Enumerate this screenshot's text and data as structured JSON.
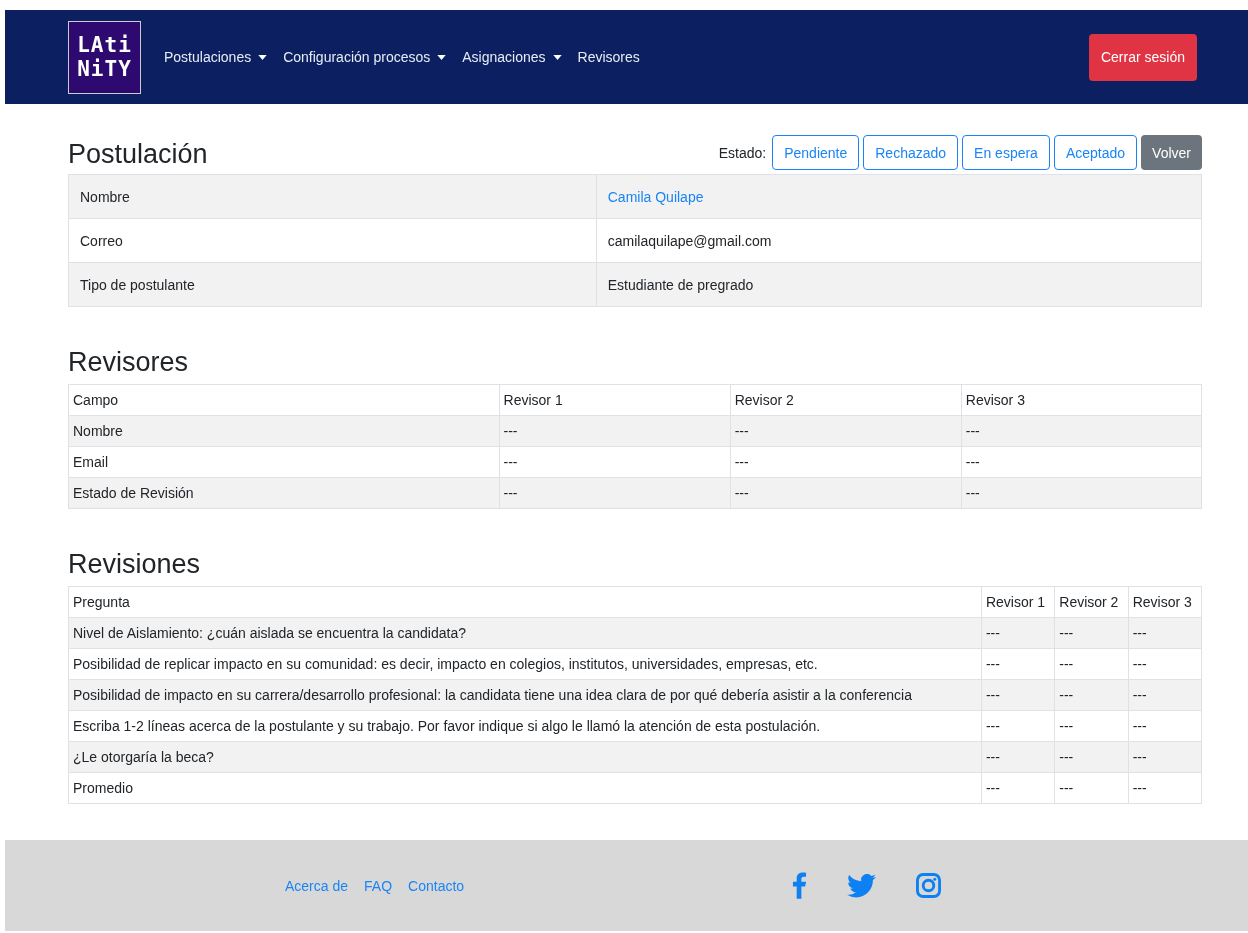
{
  "navbar": {
    "logo_lines": [
      "LAti",
      "NiTY"
    ],
    "menu": [
      {
        "label": "Postulaciones",
        "dropdown": true
      },
      {
        "label": "Configuración procesos",
        "dropdown": true
      },
      {
        "label": "Asignaciones",
        "dropdown": true
      },
      {
        "label": "Revisores",
        "dropdown": false
      }
    ],
    "logout": "Cerrar sesión"
  },
  "application": {
    "title": "Postulación",
    "status_label": "Estado:",
    "status_buttons": [
      "Pendiente",
      "Rechazado",
      "En espera",
      "Aceptado"
    ],
    "back": "Volver",
    "fields": [
      {
        "label": "Nombre",
        "value": "Camila Quilape",
        "link": true
      },
      {
        "label": "Correo",
        "value": "camilaquilape@gmail.com",
        "link": false
      },
      {
        "label": "Tipo de postulante",
        "value": "Estudiante de pregrado",
        "link": false
      }
    ]
  },
  "reviewers": {
    "title": "Revisores",
    "columns": [
      "Campo",
      "Revisor 1",
      "Revisor 2",
      "Revisor 3"
    ],
    "rows": [
      [
        "Nombre",
        "---",
        "---",
        "---"
      ],
      [
        "Email",
        "---",
        "---",
        "---"
      ],
      [
        "Estado de Revisión",
        "---",
        "---",
        "---"
      ]
    ]
  },
  "reviews": {
    "title": "Revisiones",
    "columns": [
      "Pregunta",
      "Revisor 1",
      "Revisor 2",
      "Revisor 3"
    ],
    "rows": [
      [
        "Nivel de Aislamiento: ¿cuán aislada se encuentra la candidata?",
        "---",
        "---",
        "---"
      ],
      [
        "Posibilidad de replicar impacto en su comunidad: es decir, impacto en colegios, institutos, universidades, empresas, etc.",
        "---",
        "---",
        "---"
      ],
      [
        "Posibilidad de impacto en su carrera/desarrollo profesional: la candidata tiene una idea clara de por qué debería asistir a la conferencia",
        "---",
        "---",
        "---"
      ],
      [
        "Escriba 1-2 líneas acerca de la postulante y su trabajo. Por favor indique si algo le llamó la atención de esta postulación.",
        "---",
        "---",
        "---"
      ],
      [
        "¿Le otorgaría la beca?",
        "---",
        "---",
        "---"
      ],
      [
        "Promedio",
        "---",
        "---",
        "---"
      ]
    ]
  },
  "footer": {
    "links": [
      "Acerca de",
      "FAQ",
      "Contacto"
    ]
  }
}
